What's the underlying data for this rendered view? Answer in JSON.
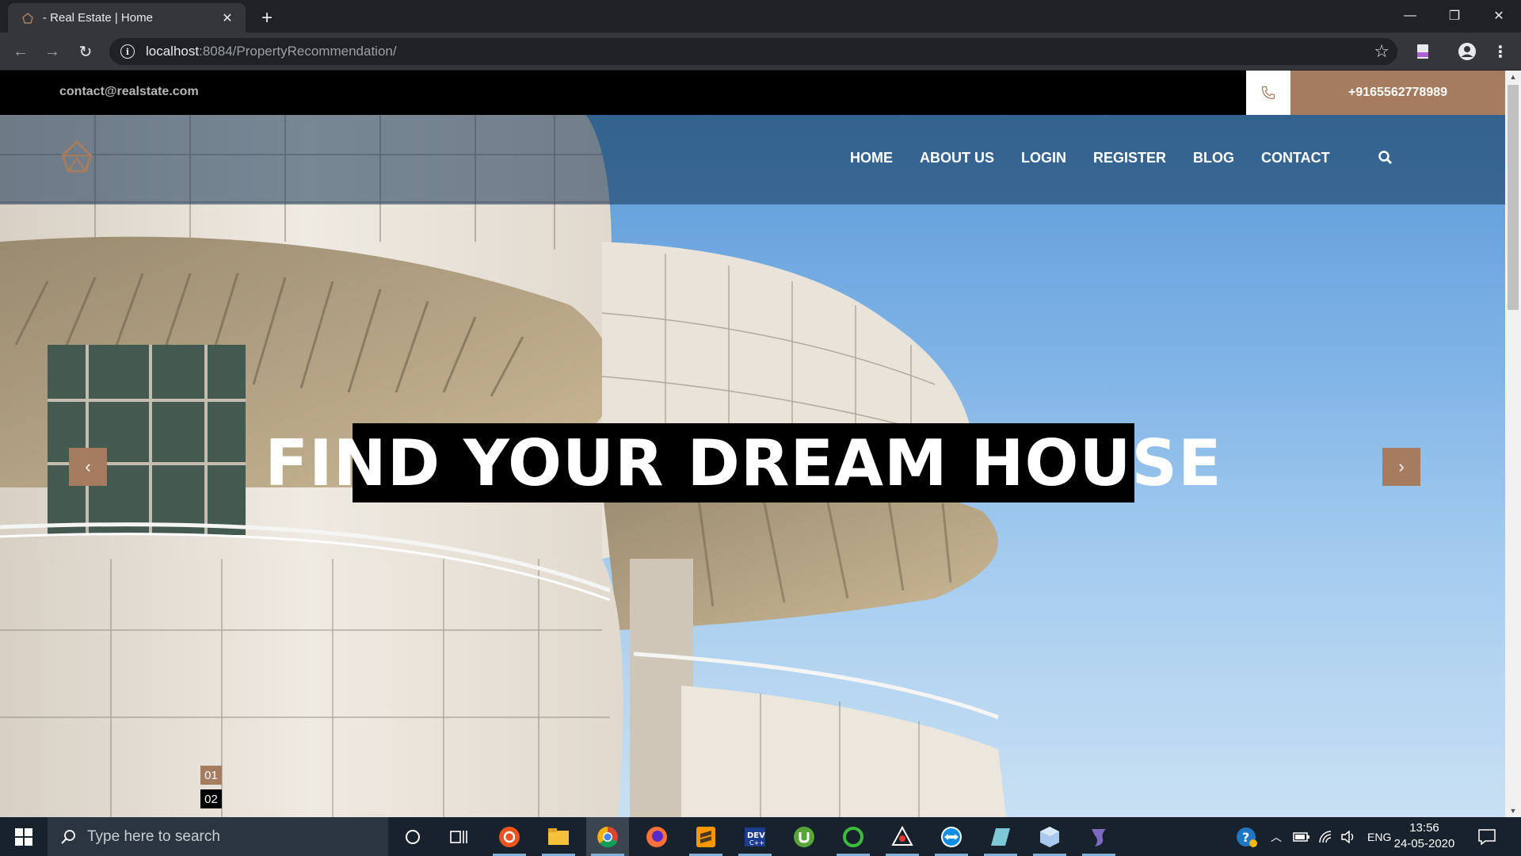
{
  "browser": {
    "tab_title": "- Real Estate | Home",
    "url_host": "localhost",
    "url_path": ":8084/PropertyRecommendation/"
  },
  "site": {
    "email": "contact@realstate.com",
    "phone": "+9165562778989",
    "nav": [
      "HOME",
      "ABOUT US",
      "LOGIN",
      "REGISTER",
      "BLOG",
      "CONTACT"
    ],
    "hero_title": "FIND YOUR DREAM HOUSE",
    "prev_label": "‹",
    "next_label": "›",
    "pager": [
      "01",
      "02"
    ],
    "accent_color": "#a57c5f"
  },
  "taskbar": {
    "search_placeholder": "Type here to search",
    "language": "ENG",
    "time": "13:56",
    "date": "24-05-2020"
  }
}
